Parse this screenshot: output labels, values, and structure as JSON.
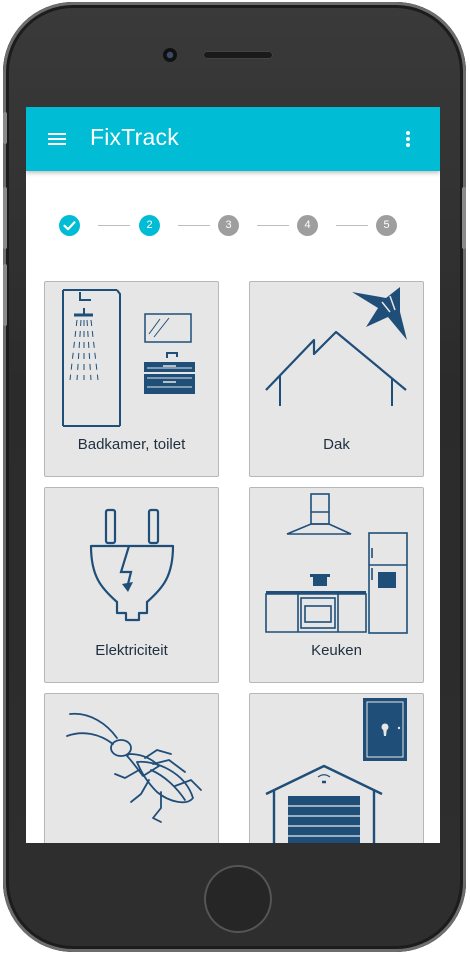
{
  "app": {
    "title": "FixTrack"
  },
  "stepper": {
    "steps": [
      {
        "label": "",
        "state": "done"
      },
      {
        "label": "2",
        "state": "active"
      },
      {
        "label": "3",
        "state": "todo"
      },
      {
        "label": "4",
        "state": "todo"
      },
      {
        "label": "5",
        "state": "todo"
      }
    ]
  },
  "categories": [
    {
      "label": "Badkamer, toilet",
      "icon": "bathroom-icon"
    },
    {
      "label": "Dak",
      "icon": "roof-icon"
    },
    {
      "label": "Elektriciteit",
      "icon": "electric-plug-icon"
    },
    {
      "label": "Keuken",
      "icon": "kitchen-icon"
    },
    {
      "label": "",
      "icon": "cockroach-icon"
    },
    {
      "label": "",
      "icon": "garage-door-icon"
    }
  ],
  "colors": {
    "accent": "#00bcd4",
    "icon_stroke": "#1f4e79",
    "tile_bg": "#e6e6e6",
    "inactive_step": "#9e9e9e"
  }
}
